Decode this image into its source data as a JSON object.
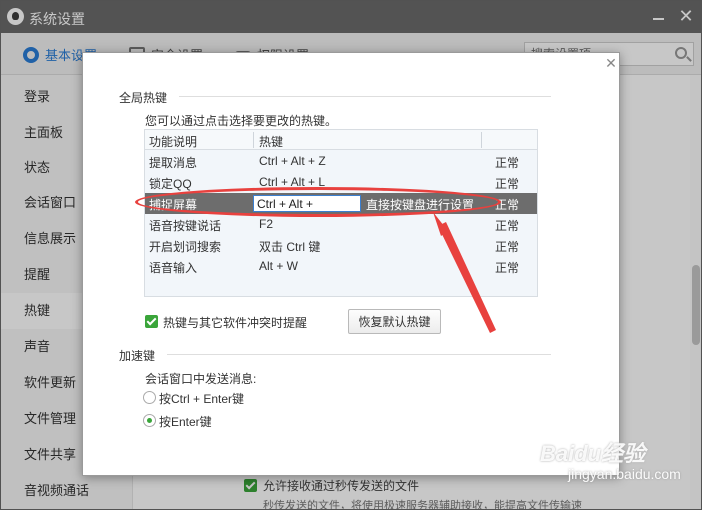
{
  "window": {
    "title": "系统设置"
  },
  "tabs": [
    {
      "label": "基本设置",
      "icon": "gear-icon"
    },
    {
      "label": "安全设置",
      "icon": "shield-icon"
    },
    {
      "label": "权限设置",
      "icon": "lock-icon"
    }
  ],
  "search": {
    "placeholder": "搜索设置项"
  },
  "sidebar": {
    "items": [
      {
        "label": "登录"
      },
      {
        "label": "主面板"
      },
      {
        "label": "状态"
      },
      {
        "label": "会话窗口"
      },
      {
        "label": "信息展示"
      },
      {
        "label": "提醒"
      },
      {
        "label": "热键"
      },
      {
        "label": "声音"
      },
      {
        "label": "软件更新"
      },
      {
        "label": "文件管理"
      },
      {
        "label": "文件共享"
      },
      {
        "label": "音视频通话"
      }
    ],
    "active": "热键"
  },
  "background": {
    "checkbox_label": "允许接收通过秒传发送的文件",
    "description": "秒传发送的文件，将使用极速服务器辅助接收，能提高文件传输速"
  },
  "dialog": {
    "global_hotkey_title": "全局热键",
    "hint": "您可以通过点击选择要更改的热键。",
    "table": {
      "headers": [
        "功能说明",
        "热键"
      ],
      "rows": [
        {
          "func": "提取消息",
          "key": "Ctrl + Alt + Z",
          "status": "正常"
        },
        {
          "func": "锁定QQ",
          "key": "Ctrl + Alt + L",
          "status": "正常"
        },
        {
          "func": "捕捉屏幕",
          "key": "Ctrl + Alt + ",
          "status": "正常",
          "hint": "直接按键盘进行设置"
        },
        {
          "func": "语音按键说话",
          "key": "F2",
          "status": "正常"
        },
        {
          "func": "开启划词搜索",
          "key": "双击 Ctrl 键",
          "status": "正常"
        },
        {
          "func": "语音输入",
          "key": "Alt + W",
          "status": "正常"
        }
      ]
    },
    "conflict_label": "热键与其它软件冲突时提醒",
    "conflict_checked": true,
    "restore_button": "恢复默认热键",
    "accel_title": "加速键",
    "send_label": "会话窗口中发送消息:",
    "options": [
      {
        "label": "按Ctrl + Enter键",
        "selected": false
      },
      {
        "label": "按Enter键",
        "selected": true
      }
    ]
  },
  "watermark": {
    "logo": "Baidu经验",
    "sub": "jingyan.baidu.com"
  },
  "colors": {
    "accent": "#2a7dd6",
    "check": "#3aa53a",
    "selected_row": "#6d6d6d",
    "annotation": "#e8413e"
  }
}
